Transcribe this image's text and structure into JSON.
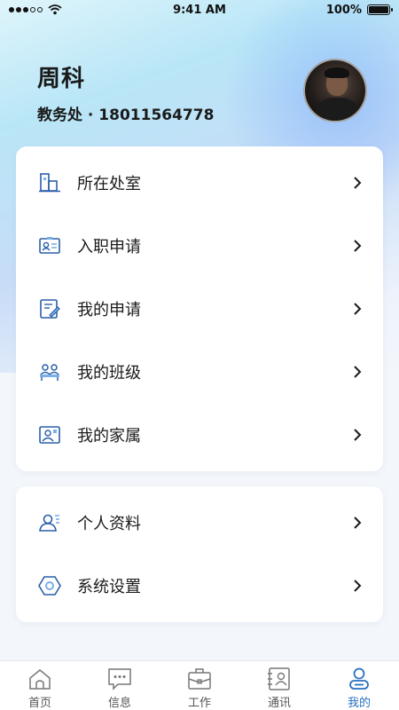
{
  "status_bar": {
    "time": "9:41 AM",
    "battery": "100%"
  },
  "profile": {
    "name": "周科",
    "subtitle": "教务处 · 18011564778"
  },
  "menu_primary": [
    {
      "label": "所在处室",
      "icon": "office-building-icon"
    },
    {
      "label": "入职申请",
      "icon": "id-card-icon"
    },
    {
      "label": "我的申请",
      "icon": "document-edit-icon"
    },
    {
      "label": "我的班级",
      "icon": "classroom-icon"
    },
    {
      "label": "我的家属",
      "icon": "family-photo-icon"
    }
  ],
  "menu_secondary": [
    {
      "label": "个人资料",
      "icon": "person-profile-icon"
    },
    {
      "label": "系统设置",
      "icon": "settings-hexagon-icon"
    }
  ],
  "tabbar": {
    "items": [
      {
        "label": "首页",
        "icon": "home-icon"
      },
      {
        "label": "信息",
        "icon": "message-icon"
      },
      {
        "label": "工作",
        "icon": "briefcase-icon"
      },
      {
        "label": "通讯",
        "icon": "contacts-icon"
      },
      {
        "label": "我的",
        "icon": "user-icon"
      }
    ],
    "active": "我的"
  },
  "colors": {
    "accent": "#2a6fc0",
    "icon_blue": "#2a5fa8"
  }
}
